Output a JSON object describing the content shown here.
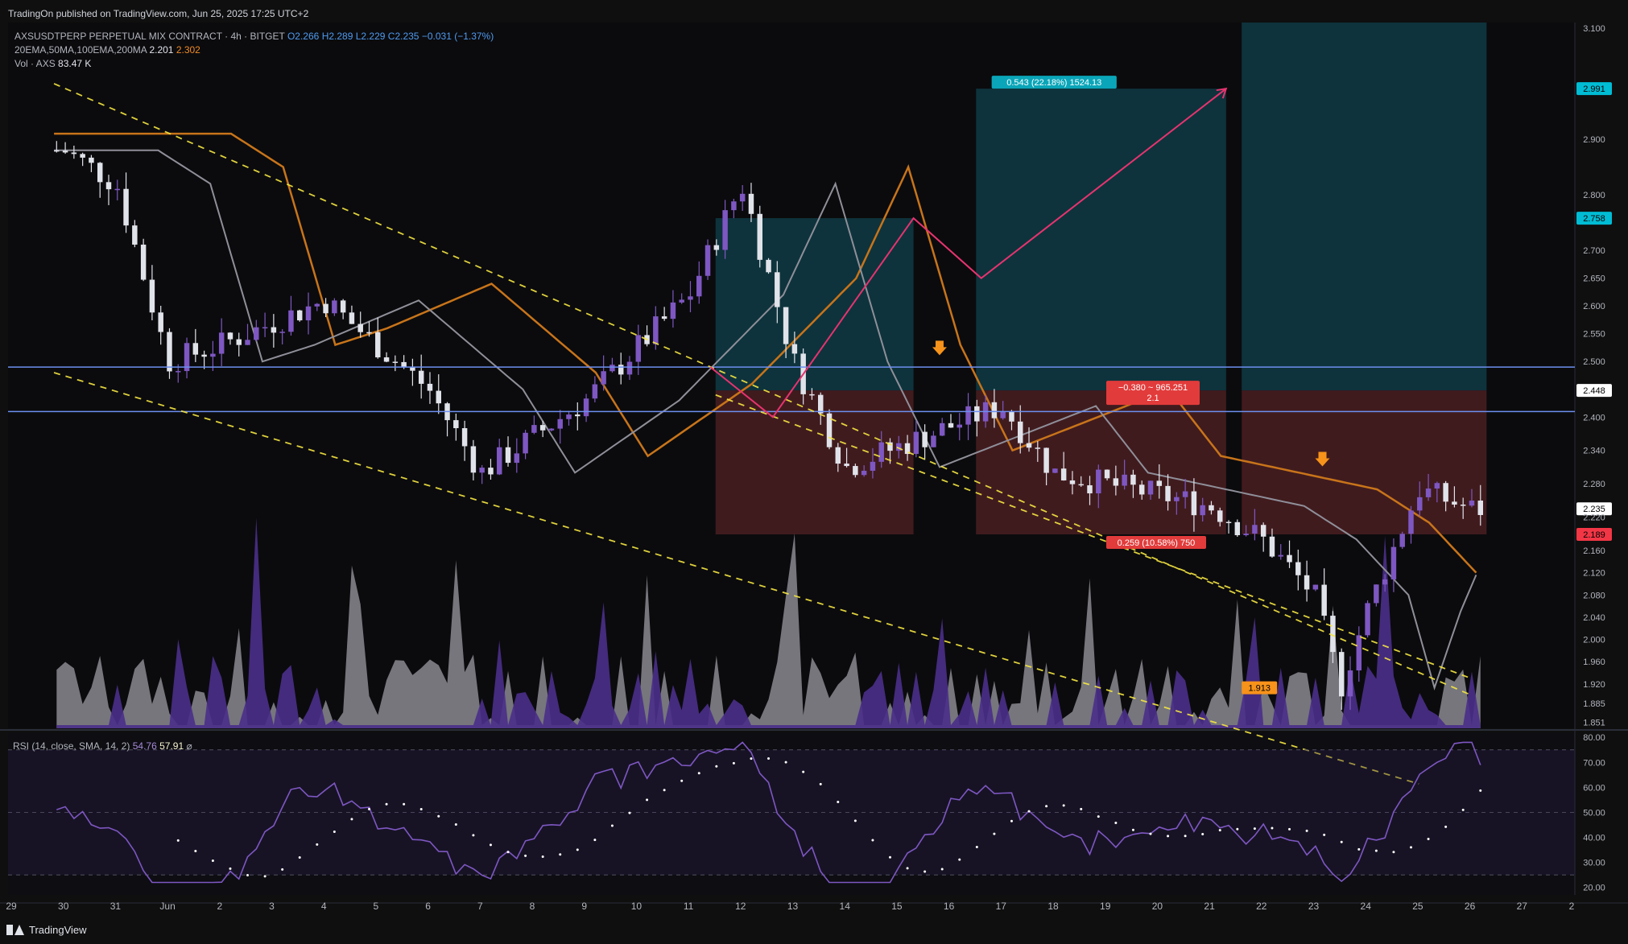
{
  "publish_line": "TradingOn published on TradingView.com, Jun 25, 2025 17:25 UTC+2",
  "legend": {
    "symbol": "AXSUSDTPERP PERPETUAL MIX CONTRACT · 4h · BITGET",
    "o": "O2.266",
    "h": "H2.289",
    "l": "L2.229",
    "c": "C2.235",
    "chg": "−0.031 (−1.37%)",
    "ema_label": "20EMA,50MA,100EMA,200MA",
    "ema_val1": "2.201",
    "ema_val2": "2.302",
    "vol_label": "Vol · AXS",
    "vol_val": "83.47 K",
    "rsi_label": "RSI (14, close, SMA, 14, 2)",
    "rsi_val1": "54.76",
    "rsi_val2": "57.91",
    "rsi_extra": "⌀"
  },
  "footer_text": "TradingView",
  "colors": {
    "bg": "#0f0f0f",
    "up": "#7e57c2",
    "down": "#e1e3ea",
    "ema_orange": "#c8741a",
    "ma_gray": "#8f8f99",
    "trend_yellow": "#f5e642",
    "hline_blue": "#6d8ff0",
    "profit_fill": "#0f3b45",
    "loss_fill": "#4a1f22",
    "path_pink": "#e7336f",
    "arrow_orange": "#f7931a",
    "rsi_line": "#7e57c2"
  },
  "chart_data": [
    {
      "type": "candlestick",
      "title": "",
      "y_axis_ticks": [
        "3.100",
        "2.991",
        "2.900",
        "2.800",
        "2.758",
        "2.700",
        "2.650",
        "2.600",
        "2.550",
        "2.500",
        "2.448",
        "2.400",
        "2.340",
        "2.280",
        "2.235",
        "2.220",
        "2.189",
        "2.160",
        "2.120",
        "2.080",
        "2.040",
        "2.000",
        "1.960",
        "1.920",
        "1.885",
        "1.851"
      ],
      "ylim": [
        1.84,
        3.11
      ],
      "x_axis_ticks": [
        "29",
        "30",
        "31",
        "Jun",
        "2",
        "3",
        "4",
        "5",
        "6",
        "7",
        "8",
        "9",
        "10",
        "11",
        "12",
        "13",
        "14",
        "15",
        "16",
        "17",
        "18",
        "19",
        "20",
        "21",
        "22",
        "23",
        "24",
        "25",
        "26",
        "27",
        "2"
      ],
      "price_badges": [
        {
          "label": "2.991",
          "value": 2.991,
          "color": "#00bcd4"
        },
        {
          "label": "2.758",
          "value": 2.758,
          "color": "#00bcd4"
        },
        {
          "label": "2.448",
          "value": 2.448,
          "color": "#ffffff"
        },
        {
          "label": "2.235",
          "value": 2.235,
          "color": "#ffffff"
        },
        {
          "label": "2.189",
          "value": 2.189,
          "color": "#f23645"
        }
      ],
      "annotations": [
        {
          "text": "0.543 (22.18%) 1524.13",
          "kind": "target-label"
        },
        {
          "text": "−0.380 ~ 965.251",
          "kind": "stop-label-line1"
        },
        {
          "text": "2.1",
          "kind": "stop-label-line2"
        },
        {
          "text": "0.259 (10.58%) 750",
          "kind": "loss-label"
        },
        {
          "text": "1.913",
          "kind": "low-label"
        }
      ],
      "horizontal_levels": [
        2.49,
        2.41
      ],
      "key_points": [
        {
          "x": "29",
          "close": 2.88
        },
        {
          "x": "30",
          "close": 2.82
        },
        {
          "x": "31",
          "close": 2.5
        },
        {
          "x": "Jun",
          "close": 2.53
        },
        {
          "x": "3",
          "close": 2.61
        },
        {
          "x": "5",
          "close": 2.45
        },
        {
          "x": "6",
          "close": 2.3
        },
        {
          "x": "8",
          "close": 2.43
        },
        {
          "x": "10",
          "close": 2.62
        },
        {
          "x": "11",
          "close": 2.82
        },
        {
          "x": "12",
          "close": 2.5
        },
        {
          "x": "13",
          "close": 2.31
        },
        {
          "x": "16",
          "close": 2.42
        },
        {
          "x": "17",
          "close": 2.3
        },
        {
          "x": "20",
          "close": 2.24
        },
        {
          "x": "21",
          "close": 2.18
        },
        {
          "x": "22",
          "close": 2.08
        },
        {
          "x": "22",
          "close": 1.913
        },
        {
          "x": "23",
          "close": 2.05
        },
        {
          "x": "24",
          "close": 2.27
        },
        {
          "x": "25",
          "close": 2.235
        }
      ]
    },
    {
      "type": "line",
      "title": "",
      "series": [
        {
          "name": "RSI (14, close, SMA, 14, 2)",
          "last_values": [
            54.76,
            57.91
          ]
        }
      ],
      "y_axis_ticks": [
        "80.00",
        "70.00",
        "60.00",
        "50.00",
        "40.00",
        "30.00",
        "20.00"
      ],
      "ylim": [
        17,
        82
      ],
      "bands": [
        75,
        50,
        25
      ]
    }
  ]
}
